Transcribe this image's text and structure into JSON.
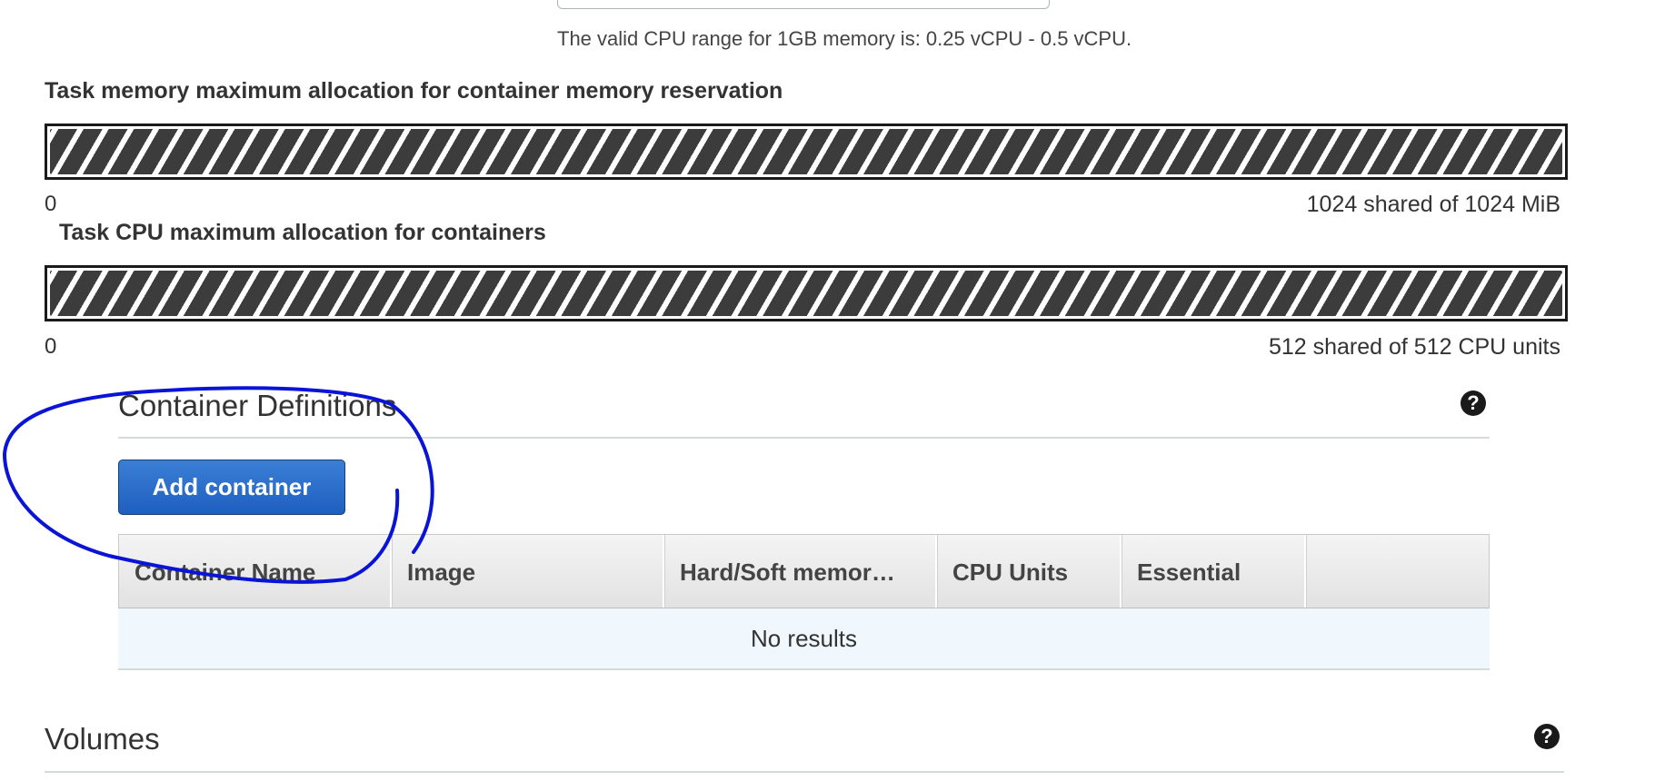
{
  "cpu": {
    "hint": "The valid CPU range for 1GB memory is: 0.25 vCPU - 0.5 vCPU."
  },
  "memory_allocation": {
    "title": "Task memory maximum allocation for container memory reservation",
    "min_label": "0",
    "max_label": "1024 shared of 1024 MiB",
    "fill_fraction": 1.0
  },
  "cpu_allocation": {
    "title": "Task CPU maximum allocation for containers",
    "min_label": "0",
    "max_label": "512 shared of 512 CPU units",
    "fill_fraction": 1.0
  },
  "container_definitions": {
    "title": "Container Definitions",
    "add_button_label": "Add container",
    "help_glyph": "?",
    "columns": [
      "Container Name",
      "Image",
      "Hard/Soft memor…",
      "CPU Units",
      "Essential",
      ""
    ],
    "empty_message": "No results"
  },
  "volumes": {
    "title": "Volumes",
    "help_glyph": "?"
  },
  "annotation": {
    "stroke_color": "#0a14d6"
  },
  "colors": {
    "button_blue": "#2a6fd0",
    "bar_stripe": "#3c3c3c",
    "empty_row_bg": "#f0f7fd"
  }
}
